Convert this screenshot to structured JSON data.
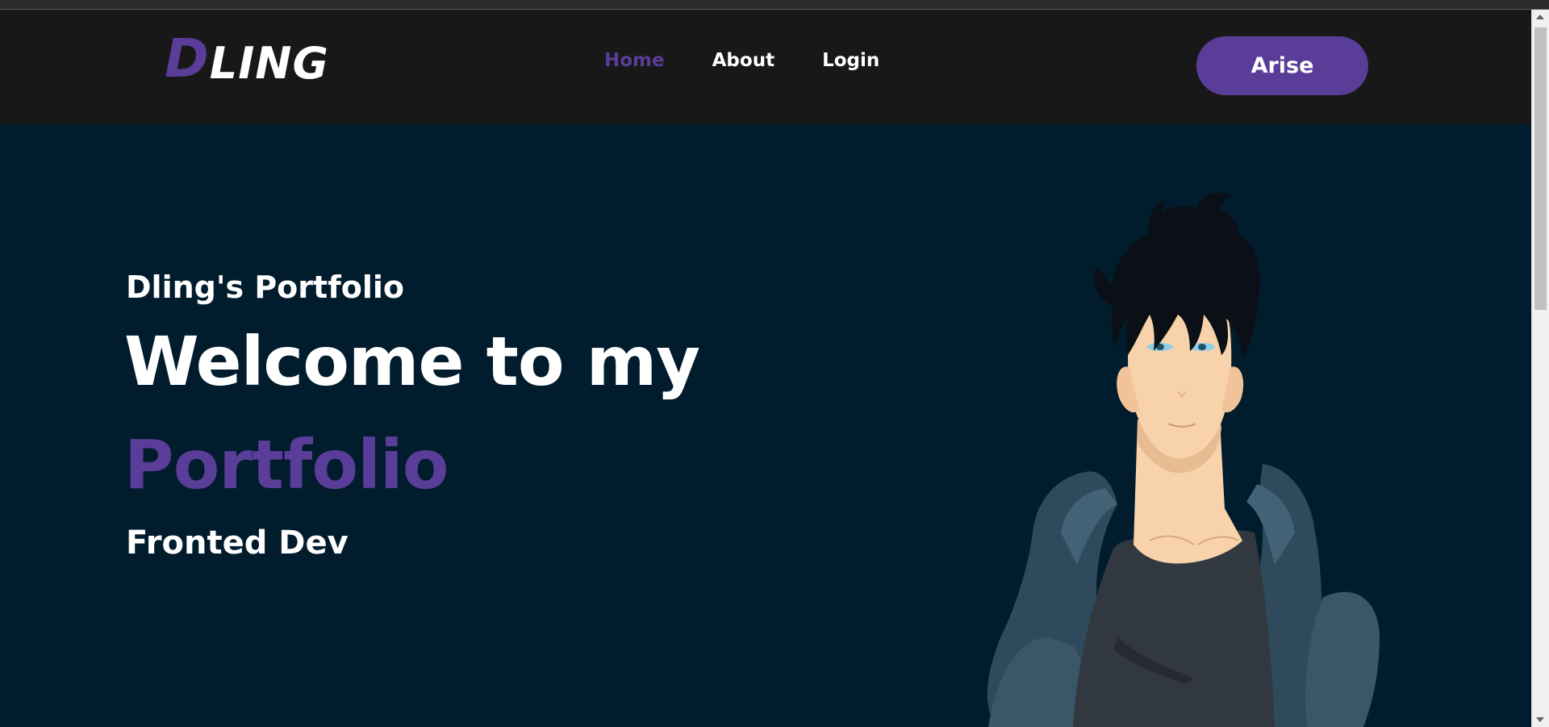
{
  "brand": {
    "logo_first": "D",
    "logo_rest": "LING",
    "accent_color": "#5a3d99",
    "nav_background": "#181818",
    "hero_background": "#011c2d"
  },
  "nav": {
    "home": "Home",
    "about": "About",
    "login": "Login",
    "active": "Home"
  },
  "cta": {
    "label": "Arise"
  },
  "hero": {
    "subtitle": "Dling's Portfolio",
    "headline": "Welcome to my",
    "headline_accent": "Portfolio",
    "role": "Fronted Dev"
  },
  "icons": {
    "illustration": "anime-character-illustration"
  }
}
